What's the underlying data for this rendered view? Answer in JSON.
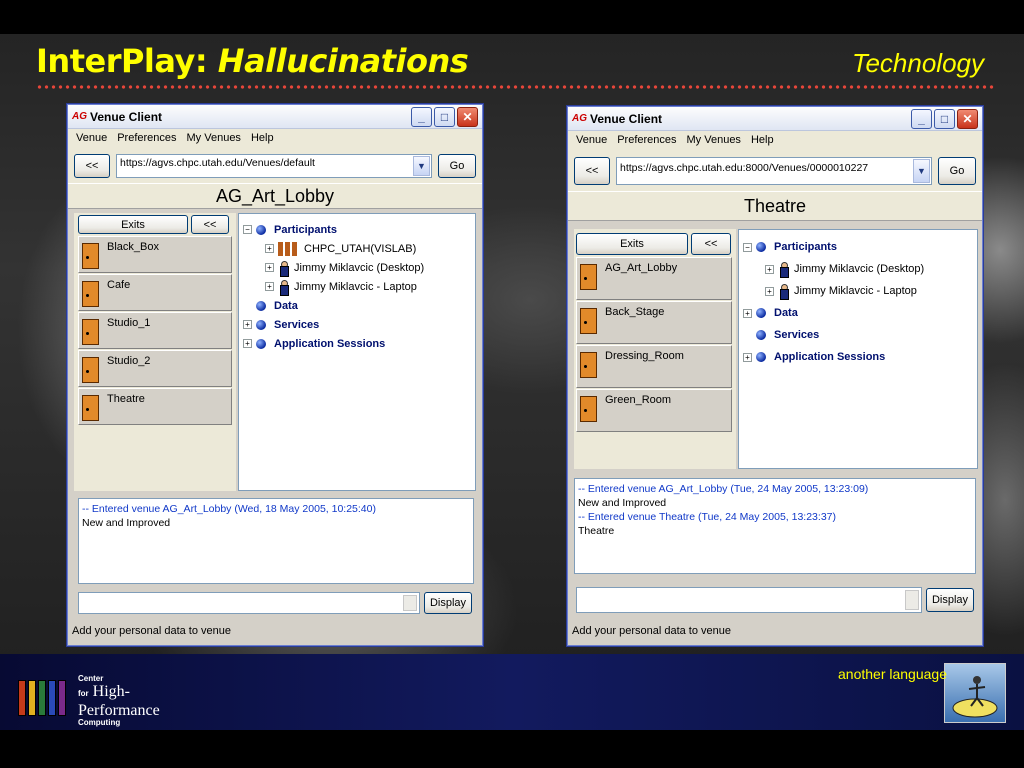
{
  "slide": {
    "title_main": "InterPlay: ",
    "title_italic": "Hallucinations",
    "subtitle_right": "Technology",
    "footer_text": "another language",
    "logo_lines": [
      "Center",
      "for",
      "High-",
      "Performance",
      "Computing"
    ]
  },
  "windows": [
    {
      "title_logo": "AG",
      "title": "Venue Client",
      "menu": [
        "Venue",
        "Preferences",
        "My Venues",
        "Help"
      ],
      "back_label": "<<",
      "url": "https://agvs.chpc.utah.edu/Venues/default",
      "go_label": "Go",
      "venue_name": "AG_Art_Lobby",
      "exits_label": "Exits",
      "collapse_label": "<<",
      "exits": [
        "Black_Box",
        "Cafe",
        "Studio_1",
        "Studio_2",
        "Theatre"
      ],
      "tree": {
        "participants": "Participants",
        "members": [
          "CHPC_UTAH(VISLAB)",
          "Jimmy Miklavcic (Desktop)",
          "Jimmy Miklavcic - Laptop"
        ],
        "data": "Data",
        "services": "Services",
        "sessions": "Application Sessions"
      },
      "log": [
        {
          "text": "-- Entered venue AG_Art_Lobby (Wed, 18 May 2005, 10:25:40)",
          "sys": true
        },
        {
          "text": "New and Improved",
          "sys": false
        }
      ],
      "display_label": "Display",
      "status": "Add your personal data to venue"
    },
    {
      "title_logo": "AG",
      "title": "Venue Client",
      "menu": [
        "Venue",
        "Preferences",
        "My Venues",
        "Help"
      ],
      "back_label": "<<",
      "url": "https://agvs.chpc.utah.edu:8000/Venues/0000010227",
      "go_label": "Go",
      "venue_name": "Theatre",
      "exits_label": "Exits",
      "collapse_label": "<<",
      "exits": [
        "AG_Art_Lobby",
        "Back_Stage",
        "Dressing_Room",
        "Green_Room"
      ],
      "tree": {
        "participants": "Participants",
        "members": [
          "Jimmy Miklavcic (Desktop)",
          "Jimmy Miklavcic - Laptop"
        ],
        "data": "Data",
        "services": "Services",
        "sessions": "Application Sessions"
      },
      "log": [
        {
          "text": "-- Entered venue AG_Art_Lobby (Tue, 24 May 2005, 13:23:09)",
          "sys": true
        },
        {
          "text": "New and Improved",
          "sys": false
        },
        {
          "text": "-- Entered venue Theatre (Tue, 24 May 2005, 13:23:37)",
          "sys": true
        },
        {
          "text": "Theatre",
          "sys": false
        }
      ],
      "display_label": "Display",
      "status": "Add your personal data to venue"
    }
  ],
  "colors": {
    "title": "#ffff00",
    "rule": "#e8463a",
    "footer": "#121a5e",
    "tree_label": "#00106e",
    "log_system": "#1038c8"
  }
}
